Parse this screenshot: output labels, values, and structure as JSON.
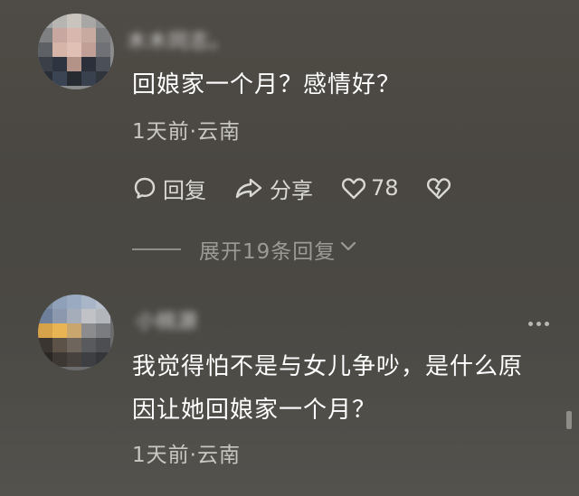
{
  "comments": [
    {
      "username": "木木同志。",
      "text": "回娘家一个月？感情好？",
      "meta": "1天前·云南",
      "actions": {
        "reply_label": "回复",
        "share_label": "分享",
        "like_count": "78"
      },
      "expand_label": "展开19条回复"
    },
    {
      "username": "小桃源",
      "text_line1": "我觉得怕不是与女儿争吵，是什么原",
      "text_line2": "因让她回娘家一个月？",
      "meta": "1天前·云南"
    }
  ],
  "icons": {
    "reply": "comment-bubble-icon",
    "share": "share-arrow-icon",
    "like": "heart-icon",
    "dislike": "broken-heart-icon",
    "expand": "chevron-down-icon",
    "more": "more-dots-icon"
  },
  "colors": {
    "background": "#4b4944",
    "text": "#ffffff",
    "meta": "#c9c7c2",
    "muted": "#9d9b96"
  }
}
